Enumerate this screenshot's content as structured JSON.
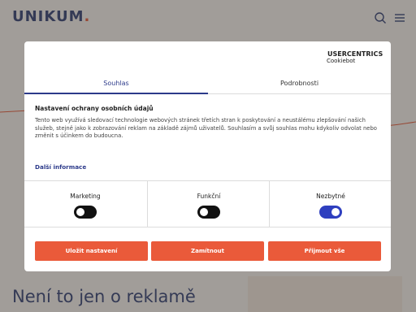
{
  "site": {
    "logo_text": "UNIKUM",
    "logo_dot": ".",
    "hero_title": "Není to jen o reklamě",
    "colors": {
      "navy": "#2f3a6b",
      "accent": "#e2522f"
    },
    "icons": [
      "search-icon",
      "menu-icon"
    ]
  },
  "dialog": {
    "brand": {
      "name": "USERCENTRICS",
      "sub": "Cookiebot"
    },
    "tabs": [
      {
        "label": "Souhlas",
        "active": true
      },
      {
        "label": "Podrobnosti",
        "active": false
      }
    ],
    "title": "Nastavení ochrany osobních údajů",
    "body": "Tento web využívá sledovací technologie webových stránek třetích stran k poskytování a neustálému zlepšování našich služeb, stejně jako k zobrazování reklam na základě zájmů uživatelů. Souhlasím a svůj souhlas mohu kdykoliv odvolat nebo změnit s účinkem do budoucna.",
    "more_link": "Další informace",
    "toggles": [
      {
        "label": "Marketing",
        "on": false
      },
      {
        "label": "Funkční",
        "on": false
      },
      {
        "label": "Nezbytné",
        "on": true
      }
    ],
    "buttons": {
      "save": "Uložit nastavení",
      "deny": "Zamítnout",
      "accept": "Přijmout vše"
    },
    "colors": {
      "button": "#ea5a3a",
      "toggle_on": "#2e3fbf",
      "toggle_off": "#111111",
      "link": "#2c3a8a"
    }
  }
}
